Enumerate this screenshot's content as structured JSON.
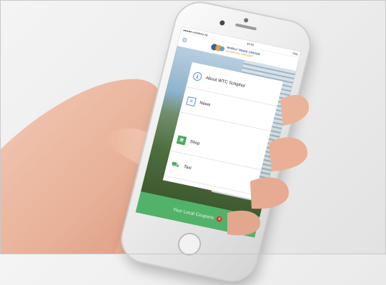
{
  "statusbar": {
    "carrier": "●●●●● vodafone NL",
    "time": "10:43",
    "battery": "79%"
  },
  "app": {
    "logo_line1": "WORLD TRADE CENTER",
    "logo_line2": "SCHIPHOL AIRPORT"
  },
  "menu": {
    "items": [
      {
        "label": "About WTC Schiphol",
        "icon": "info-icon"
      },
      {
        "label": "News",
        "icon": "news-icon"
      },
      {
        "label": "Shop",
        "icon": "shop-icon"
      },
      {
        "label": "Taxi",
        "icon": "taxi-icon"
      }
    ]
  },
  "cta": {
    "label": "Your Local Coupons",
    "badge": "2"
  },
  "colors": {
    "accent_green": "#52b26a",
    "badge_red": "#e03232",
    "icon_blue": "#5b8fd0"
  }
}
